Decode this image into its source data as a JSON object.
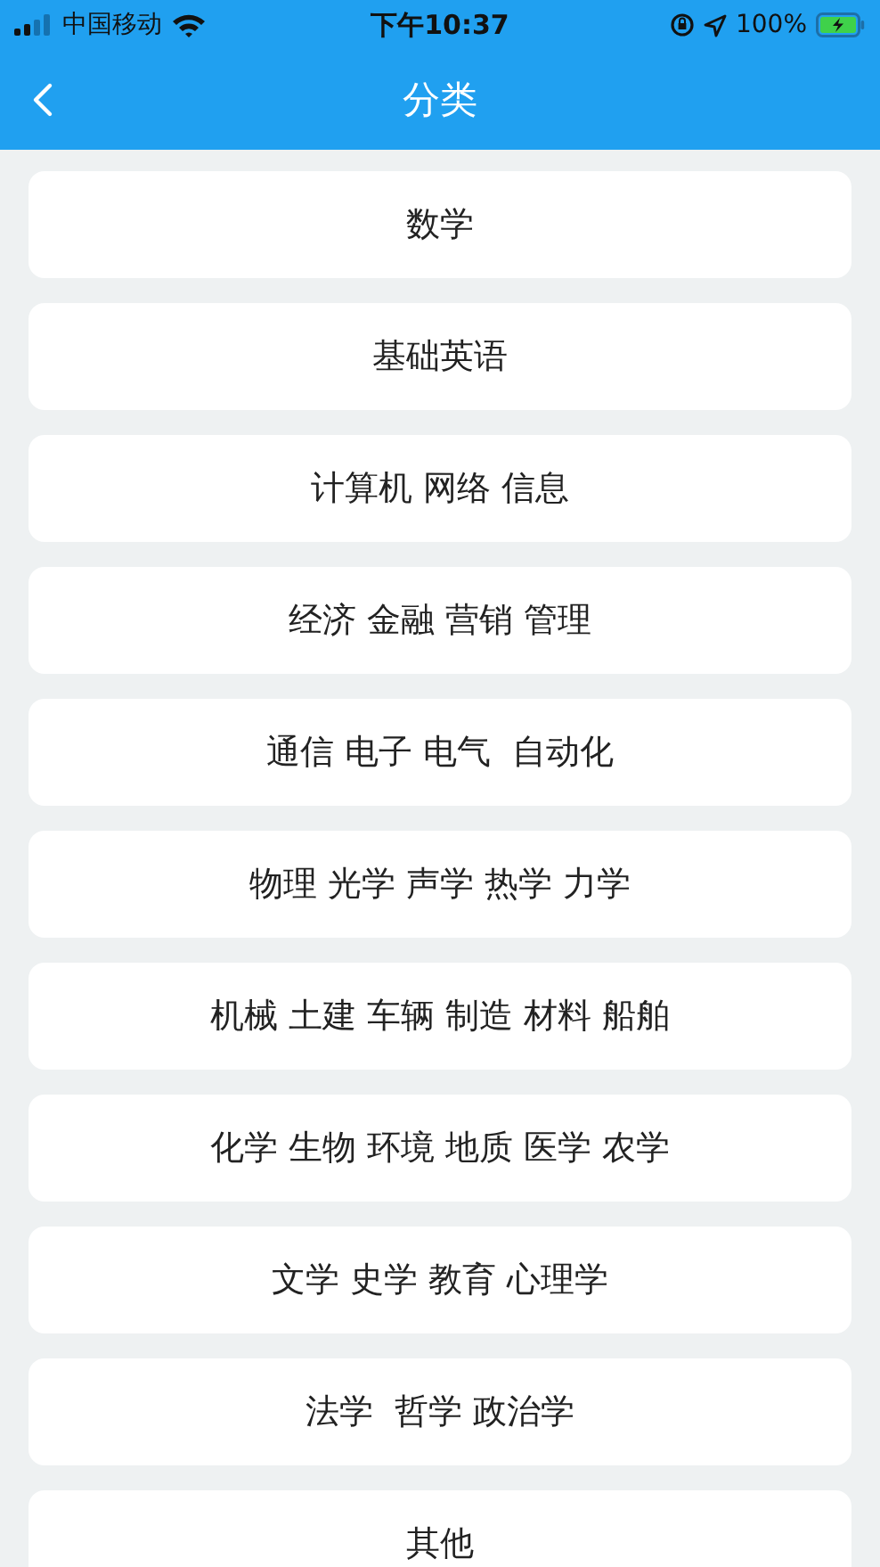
{
  "status_bar": {
    "carrier": "中国移动",
    "time": "下午10:37",
    "battery": "100%",
    "charging": true
  },
  "nav_bar": {
    "title": "分类"
  },
  "categories": [
    {
      "label": "数学"
    },
    {
      "label": "基础英语"
    },
    {
      "label": "计算机 网络 信息"
    },
    {
      "label": "经济 金融 营销 管理"
    },
    {
      "label": "通信 电子 电气  自动化"
    },
    {
      "label": "物理 光学 声学 热学 力学"
    },
    {
      "label": "机械 土建 车辆 制造 材料 船舶"
    },
    {
      "label": "化学 生物 环境 地质 医学 农学"
    },
    {
      "label": "文学 史学 教育 心理学"
    },
    {
      "label": "法学  哲学 政治学"
    },
    {
      "label": "其他"
    }
  ]
}
